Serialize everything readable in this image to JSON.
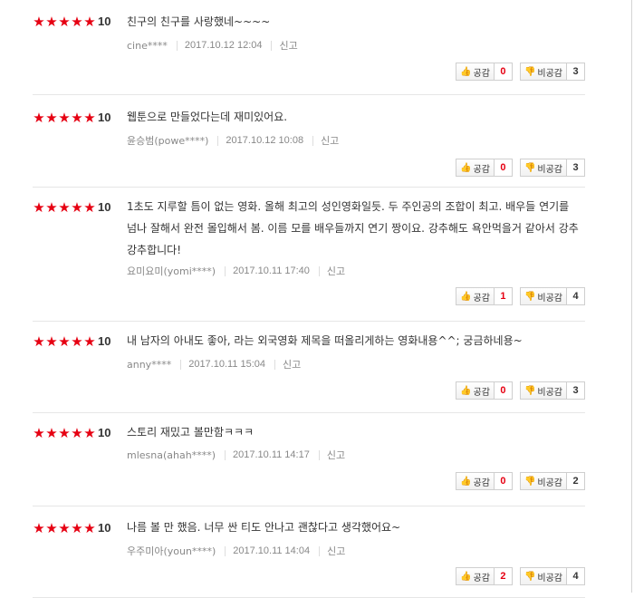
{
  "labels": {
    "like": "공감",
    "dislike": "비공감",
    "report": "신고"
  },
  "reviews": [
    {
      "stars": 5,
      "score": "10",
      "text": "친구의 친구를 사랑했네~~~~",
      "author": "cine****",
      "date": "2017.10.12 12:04",
      "likes": "0",
      "dislikes": "3"
    },
    {
      "stars": 5,
      "score": "10",
      "text": "웹툰으로 만들었다는데 재미있어요.",
      "author": "윤승범(powe****)",
      "date": "2017.10.12 10:08",
      "likes": "0",
      "dislikes": "3"
    },
    {
      "stars": 5,
      "score": "10",
      "text": "1초도 지루할 틈이 없는 영화. 올해 최고의 성인영화일듯. 두 주인공의 조합이 최고. 배우들 연기를 넘나 잘해서 완전 몰입해서 봄. 이름 모를 배우들까지 연기 짱이요. 강추해도 욕안먹을거 같아서 강추강추합니다!",
      "author": "요미요미(yomi****)",
      "date": "2017.10.11 17:40",
      "likes": "1",
      "dislikes": "4"
    },
    {
      "stars": 5,
      "score": "10",
      "text": "내 남자의 아내도 좋아, 라는 외국영화 제목을 떠올리게하는 영화내용^^; 궁금하네용~",
      "author": "anny****",
      "date": "2017.10.11 15:04",
      "likes": "0",
      "dislikes": "3"
    },
    {
      "stars": 5,
      "score": "10",
      "text": "스토리 재밌고 볼만함ㅋㅋㅋ",
      "author": "mlesna(ahah****)",
      "date": "2017.10.11 14:17",
      "likes": "0",
      "dislikes": "2"
    },
    {
      "stars": 5,
      "score": "10",
      "text": "나름 볼 만 했음. 너무 싼 티도 안나고 괜찮다고 생각했어요~",
      "author": "우주미아(youn****)",
      "date": "2017.10.11 14:04",
      "likes": "2",
      "dislikes": "4"
    }
  ]
}
